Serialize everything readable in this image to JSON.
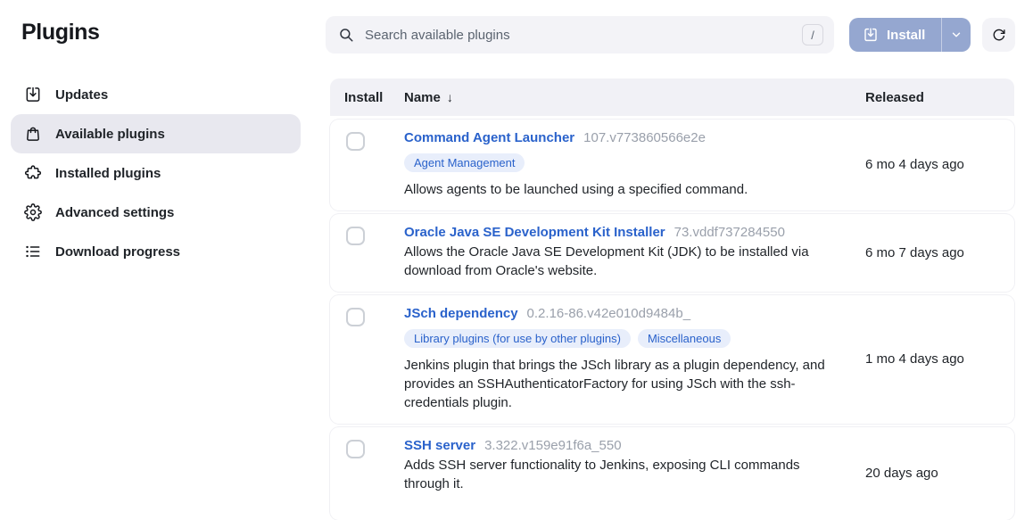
{
  "page": {
    "title": "Plugins"
  },
  "sidebar": {
    "items": [
      {
        "label": "Updates",
        "icon": "download-tray-icon",
        "selected": false
      },
      {
        "label": "Available plugins",
        "icon": "shopping-bag-icon",
        "selected": true
      },
      {
        "label": "Installed plugins",
        "icon": "puzzle-icon",
        "selected": false
      },
      {
        "label": "Advanced settings",
        "icon": "gear-icon",
        "selected": false
      },
      {
        "label": "Download progress",
        "icon": "list-icon",
        "selected": false
      }
    ]
  },
  "toolbar": {
    "search_placeholder": "Search available plugins",
    "search_shortcut": "/",
    "install_label": "Install"
  },
  "table": {
    "headers": {
      "install": "Install",
      "name": "Name",
      "released": "Released"
    },
    "sort_icon": "↓",
    "rows": [
      {
        "name": "Command Agent Launcher",
        "version": "107.v773860566e2e",
        "tags": [
          "Agent Management"
        ],
        "description": "Allows agents to be launched using a specified command.",
        "released": "6 mo 4 days ago"
      },
      {
        "name": "Oracle Java SE Development Kit Installer",
        "version": "73.vddf737284550",
        "tags": [],
        "description": "Allows the Oracle Java SE Development Kit (JDK) to be installed via download from Oracle's website.",
        "released": "6 mo 7 days ago"
      },
      {
        "name": "JSch dependency",
        "version": "0.2.16-86.v42e010d9484b_",
        "tags": [
          "Library plugins (for use by other plugins)",
          "Miscellaneous"
        ],
        "description": "Jenkins plugin that brings the JSch library as a plugin dependency, and provides an SSHAuthenticatorFactory for using JSch with the ssh-credentials plugin.",
        "released": "1 mo 4 days ago"
      },
      {
        "name": "SSH server",
        "version": "3.322.v159e91f6a_550",
        "tags": [],
        "description": "Adds SSH server functionality to Jenkins, exposing CLI commands through it.",
        "released": "20 days ago"
      }
    ]
  },
  "colors": {
    "link_blue": "#2a62cb",
    "tag_background": "#e8eefb",
    "install_button_background": "#95a7d0",
    "table_header_background": "#f1f1f6",
    "selected_sidebar_background": "#e8e8ef"
  }
}
